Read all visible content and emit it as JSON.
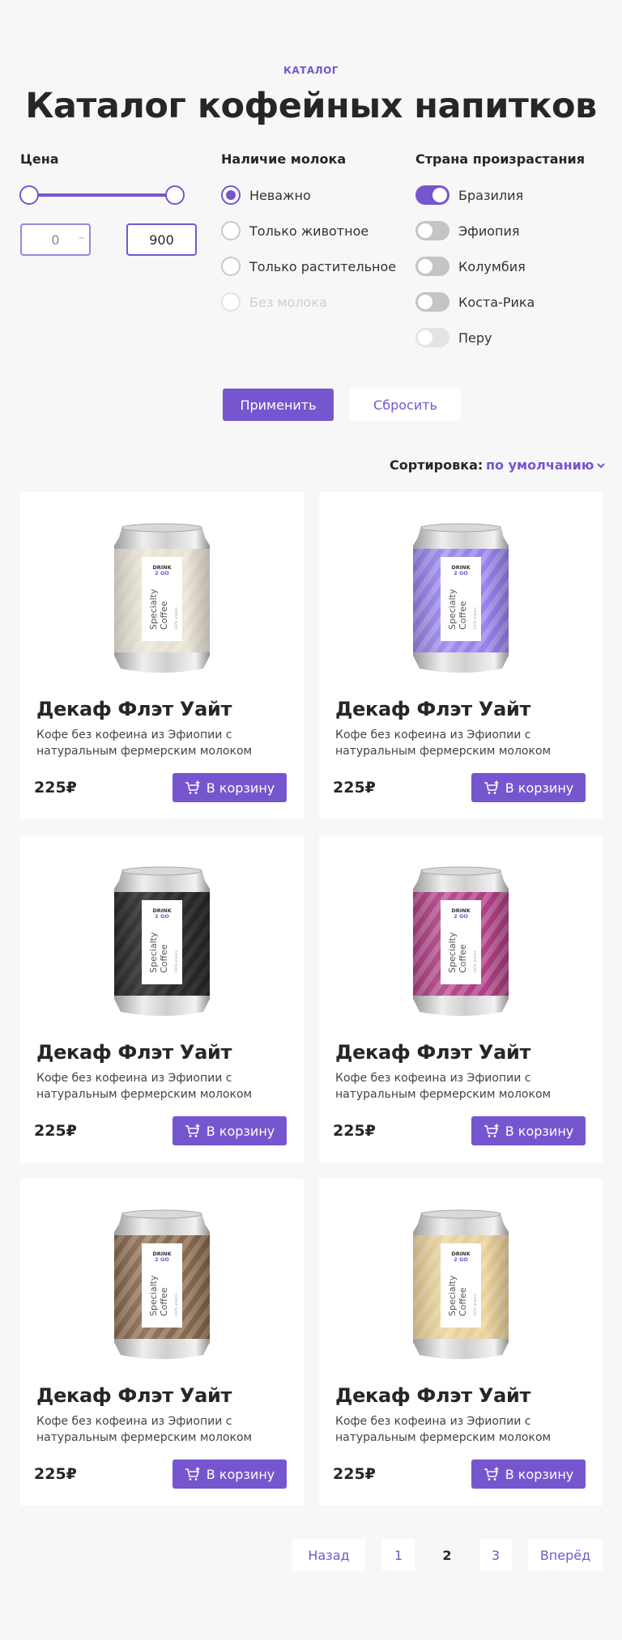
{
  "header": {
    "eyebrow": "КАТАЛОГ",
    "title": "Каталог кофейных напитков"
  },
  "filters": {
    "price": {
      "heading": "Цена",
      "min_value": "0",
      "max_value": "900"
    },
    "milk": {
      "heading": "Наличие молока",
      "options": [
        {
          "label": "Неважно",
          "checked": true,
          "disabled": false
        },
        {
          "label": "Только животное",
          "checked": false,
          "disabled": false
        },
        {
          "label": "Только растительное",
          "checked": false,
          "disabled": false
        },
        {
          "label": "Без молока",
          "checked": false,
          "disabled": true
        }
      ]
    },
    "country": {
      "heading": "Страна произрастания",
      "options": [
        {
          "label": "Бразилия",
          "on": true
        },
        {
          "label": "Эфиопия",
          "on": false
        },
        {
          "label": "Колумбия",
          "on": false
        },
        {
          "label": "Коста-Рика",
          "on": false
        },
        {
          "label": "Перу",
          "on": false
        }
      ]
    },
    "apply_label": "Применить",
    "reset_label": "Сбросить"
  },
  "sort": {
    "label": "Сортировка:",
    "value": "по умолчанию"
  },
  "brand_on_can": "DRINK 2 GO",
  "can_text": "Specialty Coffee",
  "products": [
    {
      "title": "Декаф Флэт Уайт",
      "description": "Кофе без кофеина из Эфиопии с натуральным фермерским молоком",
      "price": "225₽",
      "cart_label": "В корзину",
      "can_color": "#ece4d6"
    },
    {
      "title": "Декаф Флэт Уайт",
      "description": "Кофе без кофеина из Эфиопии с натуральным фермерским молоком",
      "price": "225₽",
      "cart_label": "В корзину",
      "can_color": "#9a84ee"
    },
    {
      "title": "Декаф Флэт Уайт",
      "description": "Кофе без кофеина из Эфиопии с натуральным фермерским молоком",
      "price": "225₽",
      "cart_label": "В корзину",
      "can_color": "#2a2a2a"
    },
    {
      "title": "Декаф Флэт Уайт",
      "description": "Кофе без кофеина из Эфиопии с натуральным фермерским молоком",
      "price": "225₽",
      "cart_label": "В корзину",
      "can_color": "#b23f86"
    },
    {
      "title": "Декаф Флэт Уайт",
      "description": "Кофе без кофеина из Эфиопии с натуральным фермерским молоком",
      "price": "225₽",
      "cart_label": "В корзину",
      "can_color": "#8a6a4e"
    },
    {
      "title": "Декаф Флэт Уайт",
      "description": "Кофе без кофеина из Эфиопии с натуральным фермерским молоком",
      "price": "225₽",
      "cart_label": "В корзину",
      "can_color": "#ecd39a"
    }
  ],
  "pagination": {
    "prev_label": "Назад",
    "pages": [
      "1",
      "2",
      "3"
    ],
    "current": "2",
    "next_label": "Вперёд"
  },
  "colors": {
    "accent": "#7656cf",
    "background": "#f7f7f7"
  }
}
